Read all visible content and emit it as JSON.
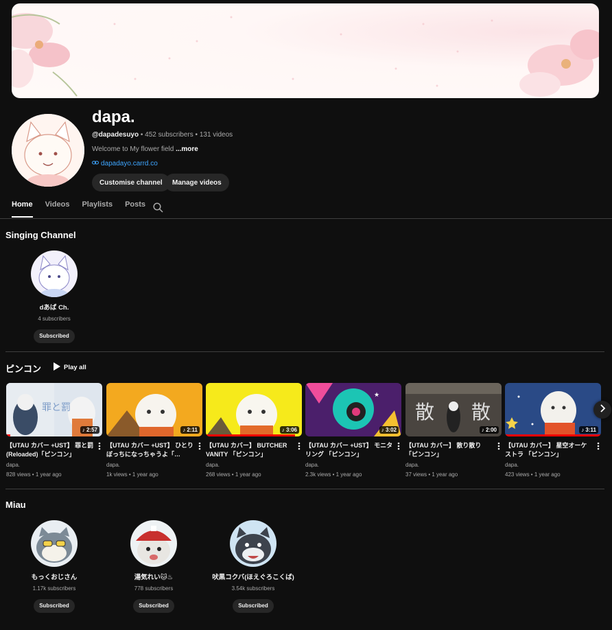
{
  "channel": {
    "name": "dapa.",
    "handle": "@dapadesuyo",
    "stats": " • 452 subscribers • 131 videos",
    "description": "Welcome to My flower field ",
    "more": "...more",
    "link": "dapadayo.carrd.co",
    "customise_label": "Customise channel",
    "manage_label": "Manage videos"
  },
  "tabs": [
    {
      "label": "Home",
      "active": true
    },
    {
      "label": "Videos"
    },
    {
      "label": "Playlists"
    },
    {
      "label": "Posts"
    }
  ],
  "sections": {
    "singing": {
      "title": "Singing Channel",
      "channels": [
        {
          "name": "dあば Ch.",
          "subs": "4 subscribers",
          "button": "Subscribed"
        }
      ]
    },
    "pincon": {
      "title": "ピンコン",
      "play_all": "Play all",
      "videos": [
        {
          "title": "【UTAU カバー +UST】 罪と罰 (Reloaded)「ピンコン」",
          "channel": "dapa.",
          "meta": "828 views • 1 year ago",
          "duration": "2:57",
          "progress": 0.04
        },
        {
          "title": "【UTAU カバー +UST】 ひとりぼっちになっちゃうよ「…",
          "channel": "dapa.",
          "meta": "1k views • 1 year ago",
          "duration": "2:11",
          "progress": 0.0
        },
        {
          "title": "【UTAU カバー】 BUTCHER VANITY 「ピンコン」",
          "channel": "dapa.",
          "meta": "268 views • 1 year ago",
          "duration": "3:06",
          "progress": 0.93
        },
        {
          "title": "【UTAU カバー +UST】 モニタリング 「ピンコン」",
          "channel": "dapa.",
          "meta": "2.3k views • 1 year ago",
          "duration": "3:02",
          "progress": 0.0
        },
        {
          "title": "【UTAU カバー】 散り散り「ピンコン」",
          "channel": "dapa.",
          "meta": "37 views • 1 year ago",
          "duration": "2:00",
          "progress": 0.0
        },
        {
          "title": "【UTAU カバー】 星空オーケストラ 「ピンコン」",
          "channel": "dapa.",
          "meta": "423 views • 1 year ago",
          "duration": "3:11",
          "progress": 1.0
        }
      ]
    },
    "miau": {
      "title": "Miau",
      "channels": [
        {
          "name": "もっくおじさん",
          "subs": "1.17k subscribers",
          "button": "Subscribed"
        },
        {
          "name": "湯気れい🐱♨",
          "subs": "778 subscribers",
          "button": "Subscribed"
        },
        {
          "name": "吠黒コクバ(ほえぐろこくば)",
          "subs": "3.54k subscribers",
          "button": "Subscribed"
        }
      ]
    }
  },
  "colors": {
    "background": "#0f0f0f",
    "accent_link": "#3ea6ff",
    "progress": "#ff0000",
    "pill": "#272727"
  }
}
